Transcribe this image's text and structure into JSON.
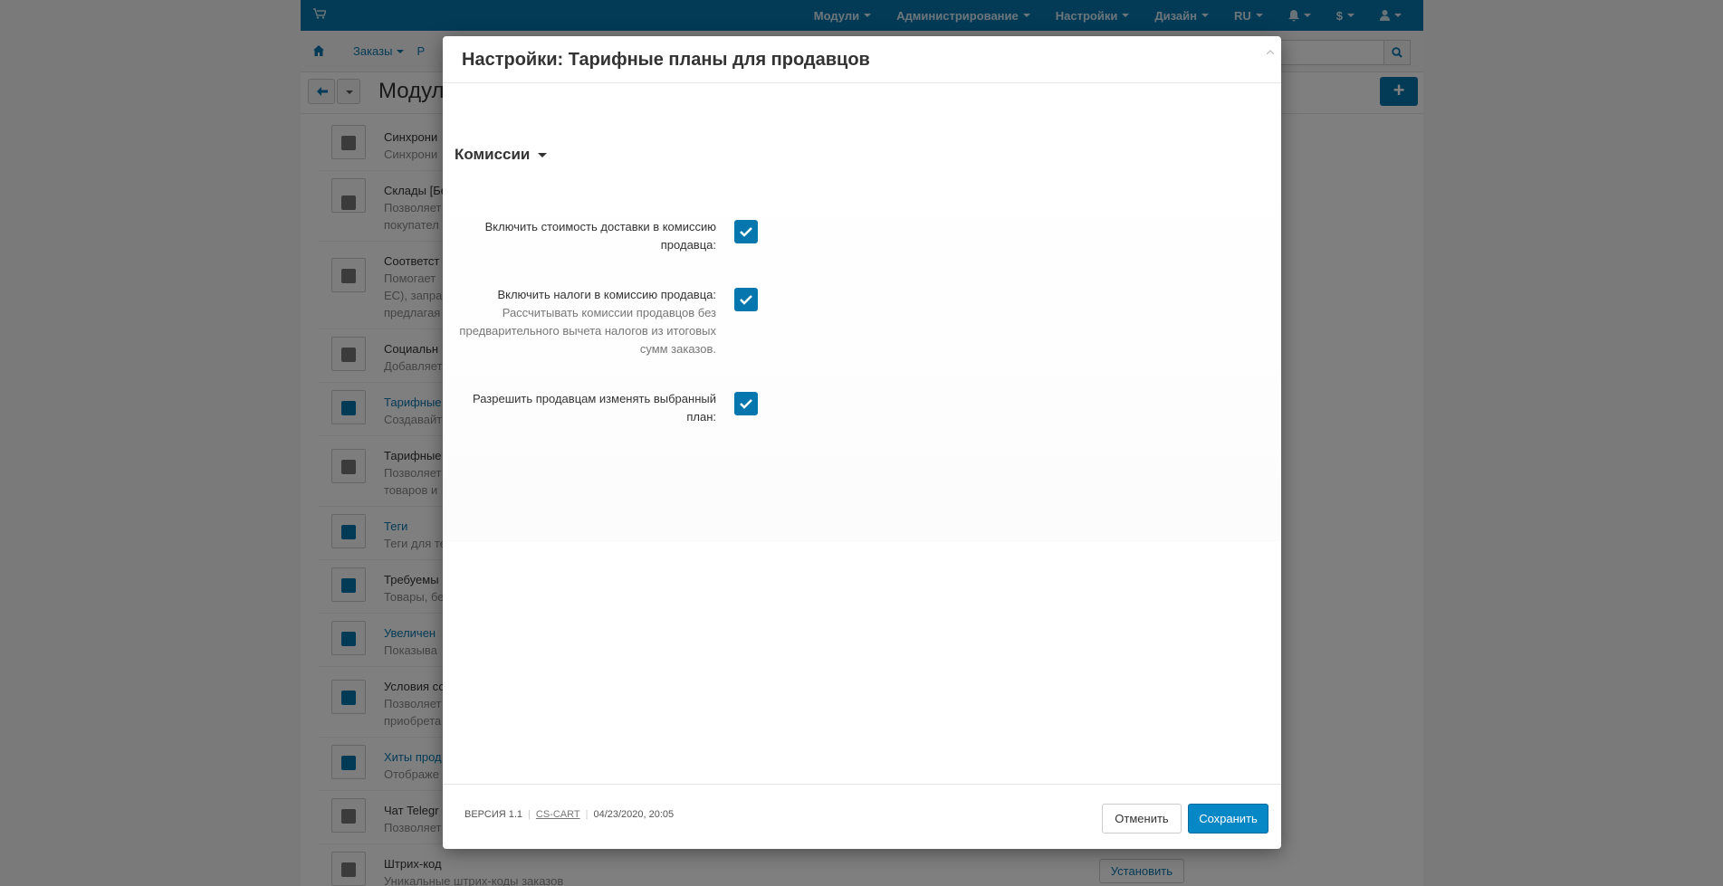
{
  "background": {
    "topnav": [
      {
        "label": "Модули"
      },
      {
        "label": "Администрирование"
      },
      {
        "label": "Настройки"
      },
      {
        "label": "Дизайн"
      },
      {
        "label": "RU"
      },
      {
        "label": ""
      },
      {
        "label": "$"
      },
      {
        "label": ""
      }
    ],
    "subnav": [
      "Заказы",
      "Р"
    ],
    "page_title": "Модул",
    "addons": [
      {
        "name": "Синхрони",
        "desc": "Синхрони",
        "active": false
      },
      {
        "name": "Склады [Бе",
        "desc": "Позволяет",
        "desc2": "покупател",
        "active": false
      },
      {
        "name": "Соответст",
        "desc": "Помогает",
        "desc2": "ЕС), запра",
        "desc3": "предлагая",
        "active": false
      },
      {
        "name": "Социальн",
        "desc": "Добавляет",
        "active": false
      },
      {
        "name": "Тарифные",
        "desc": "Создавайт",
        "active": true
      },
      {
        "name": "Тарифные",
        "desc": "Позволяет",
        "desc2": "товаров и",
        "active": false
      },
      {
        "name": "Теги",
        "desc": "Теги для те",
        "active": true
      },
      {
        "name": "Требуемы",
        "desc": "Товары, бе",
        "active": true
      },
      {
        "name": "Увеличен",
        "desc": "Показыва",
        "active": true
      },
      {
        "name": "Условия со",
        "desc": "Позволяет",
        "desc2": "приобрета",
        "active": true
      },
      {
        "name": "Хиты прод",
        "desc": "Отображе",
        "active": true
      },
      {
        "name": "Чат Telegr",
        "desc": "Позволяет",
        "active": false
      },
      {
        "name": "Штрих-код",
        "desc": "Уникальные штрих-коды заказов",
        "active": false
      }
    ],
    "install_label": "Установить"
  },
  "modal": {
    "title": "Настройки: Тарифные планы для продавцов",
    "section_title": "Комиссии",
    "settings": [
      {
        "label": "Включить стоимость доставки в комиссию продавца:",
        "hint": "",
        "checked": true
      },
      {
        "label": "Включить налоги в комиссию продавца:",
        "hint": "Рассчитывать комиссии продавцов без предварительного вычета налогов из итоговых сумм заказов.",
        "checked": true
      },
      {
        "label": "Разрешить продавцам изменять выбранный план:",
        "hint": "",
        "checked": true
      }
    ],
    "footer": {
      "version": "ВЕРСИЯ 1.1",
      "vendor": "CS-CART",
      "date": "04/23/2020, 20:05"
    },
    "buttons": {
      "cancel": "Отменить",
      "save": "Сохранить"
    }
  },
  "colors": {
    "accent": "#0677ae",
    "primary_button": "#0688c6",
    "overlay": "rgba(0,0,0,0.5)"
  }
}
